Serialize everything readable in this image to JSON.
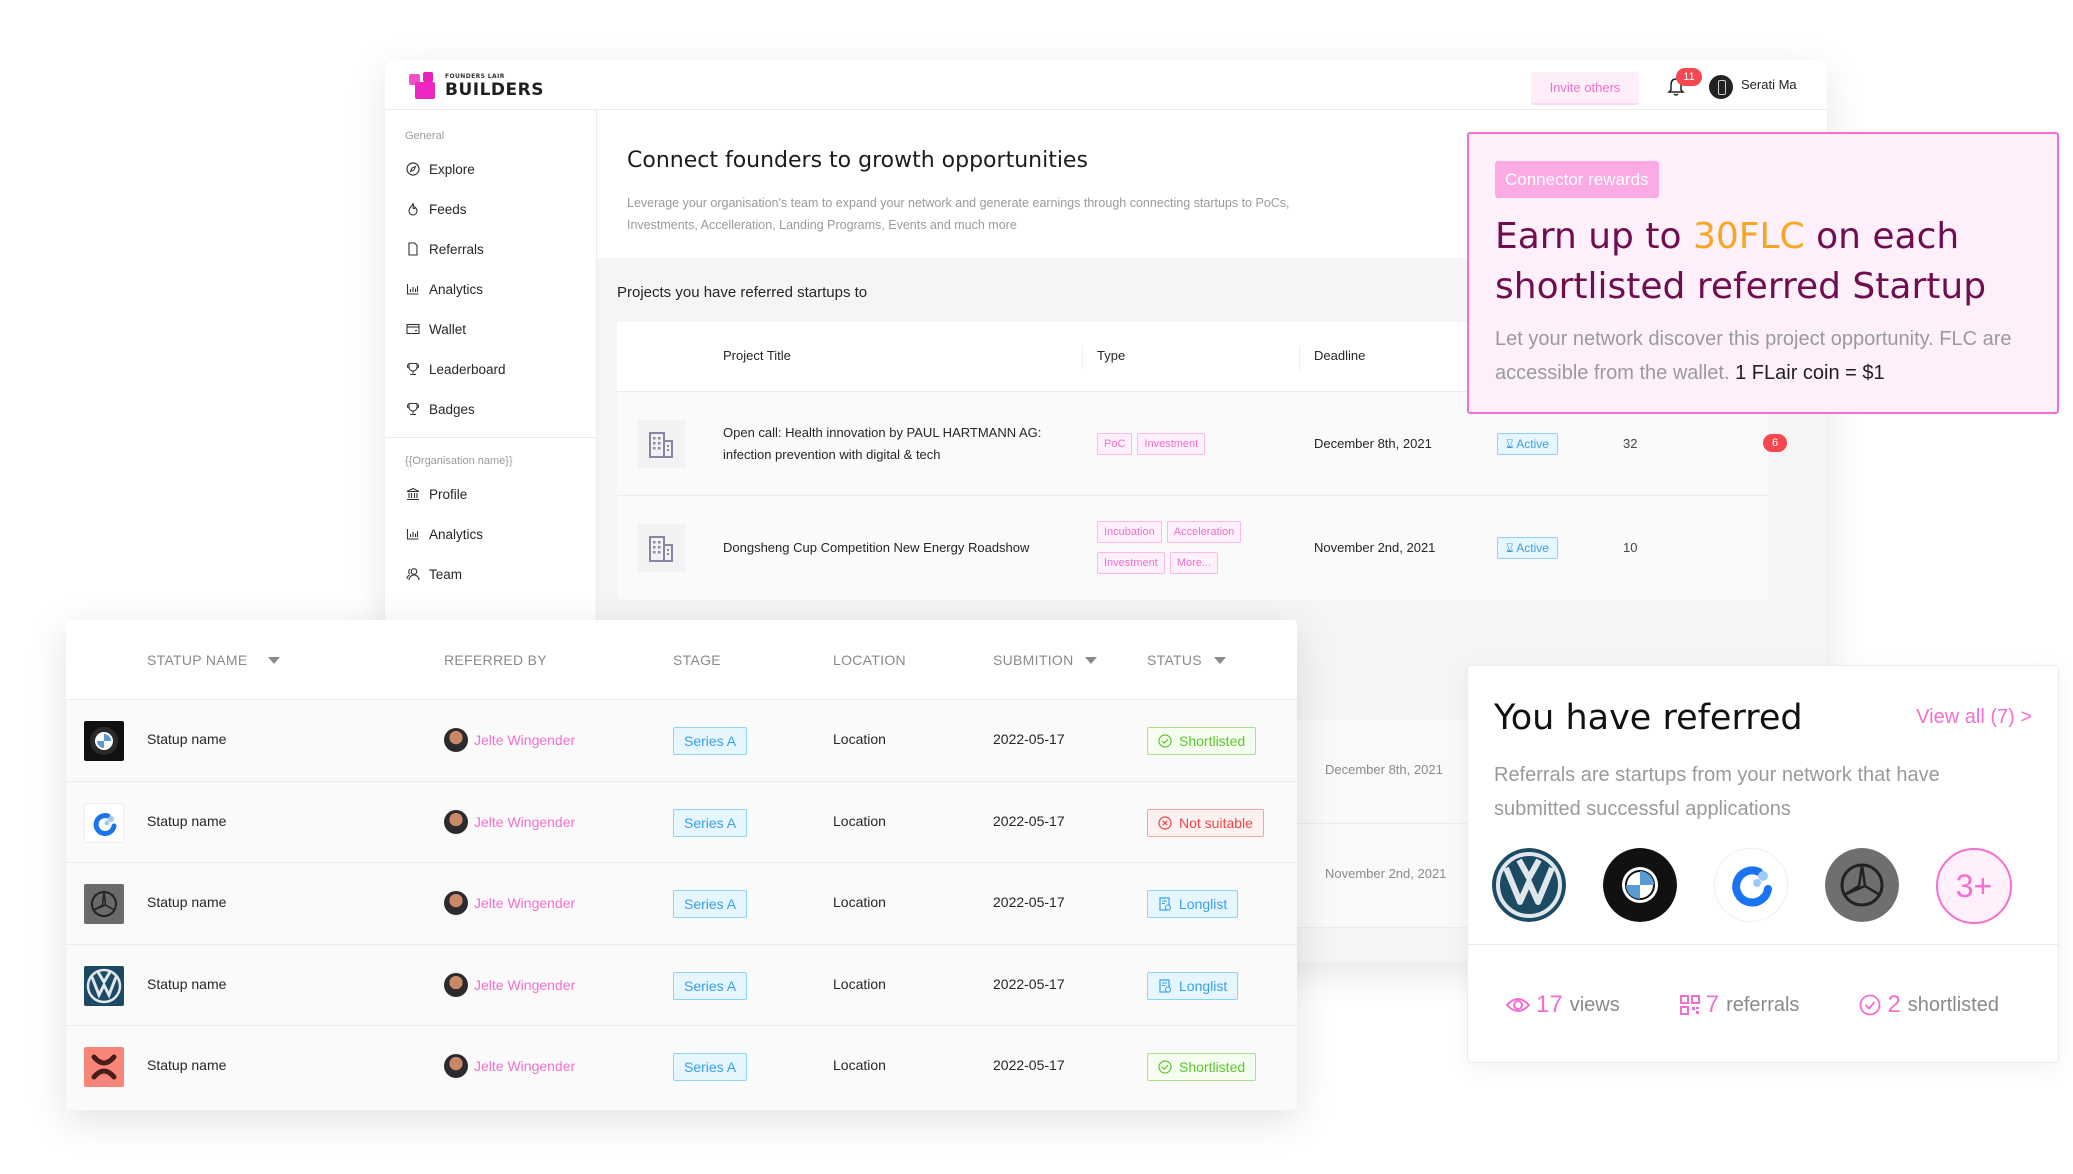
{
  "app": {
    "logo_small": "FOUNDERS LAIR",
    "logo_big": "BUILDERS",
    "invite_label": "Invite others",
    "notification_count": "11",
    "user_name": "Serati Ma"
  },
  "sidebar": {
    "general_label": "General",
    "general_items": [
      {
        "label": "Explore",
        "icon": "compass-icon"
      },
      {
        "label": "Feeds",
        "icon": "flame-icon"
      },
      {
        "label": "Referrals",
        "icon": "document-icon"
      },
      {
        "label": "Analytics",
        "icon": "bar-chart-icon"
      },
      {
        "label": "Wallet",
        "icon": "wallet-icon"
      },
      {
        "label": "Leaderboard",
        "icon": "trophy-icon"
      },
      {
        "label": "Badges",
        "icon": "trophy-icon"
      }
    ],
    "org_label": "{{Organisation name}}",
    "org_items": [
      {
        "label": "Profile",
        "icon": "bank-icon"
      },
      {
        "label": "Analytics",
        "icon": "bar-chart-icon"
      },
      {
        "label": "Team",
        "icon": "team-icon"
      }
    ]
  },
  "main": {
    "title": "Connect founders to growth opportunities",
    "description": "Leverage your organisation's team to expand your network and generate earnings through connecting startups to PoCs, Investments, Accelleration, Landing Programs, Events and much more",
    "projects_title": "Projects you have referred startups to",
    "projects_columns": [
      "Project Title",
      "Type",
      "Deadline"
    ],
    "projects": [
      {
        "title": "Open call: Health innovation by PAUL HARTMANN AG: infection prevention with digital & tech",
        "tags": [
          "PoC",
          "Investment"
        ],
        "deadline": "December 8th, 2021",
        "status": "Active",
        "count": "32",
        "badge": "6"
      },
      {
        "title": "Dongsheng Cup Competition New Energy Roadshow",
        "tags": [
          "Incubation",
          "Acceleration",
          "Investment",
          "More..."
        ],
        "deadline": "November 2nd, 2021",
        "status": "Active",
        "count": "10",
        "badge": ""
      }
    ],
    "background_deadlines": [
      "December 8th, 2021",
      "November 2nd, 2021"
    ]
  },
  "rewards": {
    "tag": "Connector rewards",
    "title_pre": "Earn up to ",
    "title_highlight": "30FLC",
    "title_post": " on each shortlisted referred Startup",
    "desc": "Let your network discover this project opportunity. FLC are accessible from the wallet. ",
    "desc_strong": "1 FLair coin = $1",
    "accent_color": "#f6a620"
  },
  "referred": {
    "title": "You have referred",
    "view_all": "View all (7) >",
    "desc": "Referrals are startups from your network that have submitted successful applications",
    "logos": [
      "volkswagen-logo",
      "bmw-logo",
      "blue-c-logo",
      "mercedes-logo"
    ],
    "more": "3+",
    "stats": [
      {
        "icon": "eye-icon",
        "value": "17",
        "label": "views"
      },
      {
        "icon": "qr-icon",
        "value": "7",
        "label": "referrals"
      },
      {
        "icon": "check-circle-icon",
        "value": "2",
        "label": "shortlisted"
      }
    ]
  },
  "startups": {
    "columns": [
      {
        "label": "STATUP NAME",
        "sortable": true
      },
      {
        "label": "REFERRED BY",
        "sortable": false
      },
      {
        "label": "STAGE",
        "sortable": false
      },
      {
        "label": "LOCATION",
        "sortable": false
      },
      {
        "label": "SUBMITION",
        "sortable": true
      },
      {
        "label": "STATUS",
        "sortable": true
      }
    ],
    "rows": [
      {
        "logo": "bmw",
        "name": "Statup name",
        "referred_by": "Jelte Wingender",
        "stage": "Series A",
        "location": "Location",
        "submission": "2022-05-17",
        "status": "Shortlisted"
      },
      {
        "logo": "blue-c",
        "name": "Statup name",
        "referred_by": "Jelte Wingender",
        "stage": "Series A",
        "location": "Location",
        "submission": "2022-05-17",
        "status": "Not suitable"
      },
      {
        "logo": "mercedes",
        "name": "Statup name",
        "referred_by": "Jelte Wingender",
        "stage": "Series A",
        "location": "Location",
        "submission": "2022-05-17",
        "status": "Longlist"
      },
      {
        "logo": "volkswagen",
        "name": "Statup name",
        "referred_by": "Jelte Wingender",
        "stage": "Series A",
        "location": "Location",
        "submission": "2022-05-17",
        "status": "Longlist"
      },
      {
        "logo": "red-x",
        "name": "Statup name",
        "referred_by": "Jelte Wingender",
        "stage": "Series A",
        "location": "Location",
        "submission": "2022-05-17",
        "status": "Shortlisted"
      }
    ]
  },
  "colors": {
    "brand_pink": "#f36fcf",
    "rewards_title": "#6f0d4f",
    "active_blue": "#3a9fe6",
    "success_green": "#5ec530",
    "error_red": "#f0444b",
    "badge_red": "#f5474f"
  }
}
